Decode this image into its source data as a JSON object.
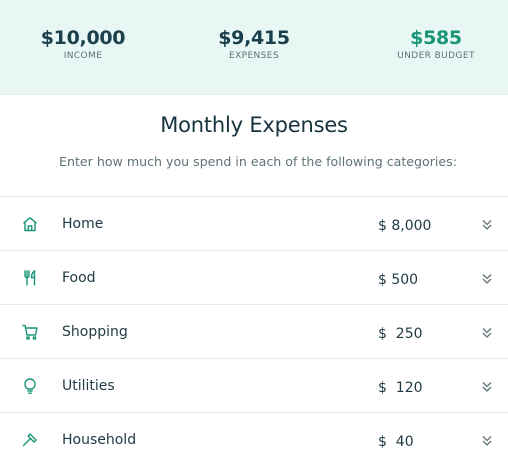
{
  "summary": {
    "income": {
      "value": "$10,000",
      "label": "INCOME"
    },
    "expenses": {
      "value": "$9,415",
      "label": "EXPENSES"
    },
    "under_budget": {
      "value": "$585",
      "label": "UNDER BUDGET"
    }
  },
  "heading": "Monthly Expenses",
  "subheading": "Enter how much you spend in each of the following categories:",
  "colors": {
    "accent": "#1a9578",
    "summary_bg": "#e8f7f4",
    "text": "#1e3943"
  },
  "categories": [
    {
      "name": "Home",
      "icon": "home-icon",
      "amount": "$ 8,000"
    },
    {
      "name": "Food",
      "icon": "utensils-icon",
      "amount": "$ 500"
    },
    {
      "name": "Shopping",
      "icon": "cart-icon",
      "amount": "$  250"
    },
    {
      "name": "Utilities",
      "icon": "lightbulb-icon",
      "amount": "$  120"
    },
    {
      "name": "Household",
      "icon": "hammer-icon",
      "amount": "$  40"
    }
  ]
}
